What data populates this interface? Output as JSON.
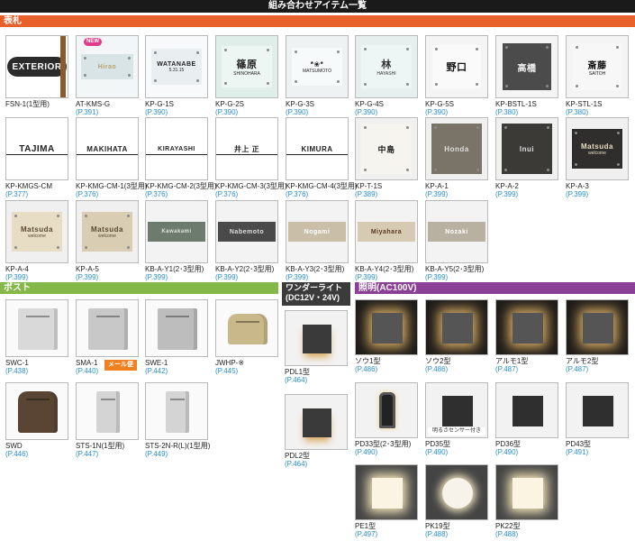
{
  "banner": {
    "title": "組み合わせアイテム一覧"
  },
  "sections": {
    "nameplate": "表札",
    "post": "ポスト",
    "wonder": "ワンダーライト(DC12V・24V)",
    "lighting": "照明(AC100V)"
  },
  "badges": {
    "new": "NEW",
    "mail": "メール便",
    "sensor": "明るさセンサー付き"
  },
  "plates": [
    {
      "code": "FSN-1(1型用)",
      "page": "",
      "text": "EXTERIOR",
      "sub": ""
    },
    {
      "code": "AT-KMS-G",
      "page": "(P.391)",
      "text": "Hirao",
      "sub": ""
    },
    {
      "code": "KP-G-1S",
      "page": "(P.390)",
      "text": "WATANABE",
      "sub": "5.31.15"
    },
    {
      "code": "KP-G-2S",
      "page": "(P.390)",
      "text": "篠原",
      "sub": "SHINOHARA"
    },
    {
      "code": "KP-G-3S",
      "page": "(P.390)",
      "text": "*❀*",
      "sub": "MATSUMOTO"
    },
    {
      "code": "KP-G-4S",
      "page": "(P.390)",
      "text": "林",
      "sub": "HAYASHI"
    },
    {
      "code": "KP-G-5S",
      "page": "(P.390)",
      "text": "野口",
      "sub": ""
    },
    {
      "code": "KP-BSTL-1S",
      "page": "(P.380)",
      "text": "高橋",
      "sub": ""
    },
    {
      "code": "KP-STL-1S",
      "page": "(P.380)",
      "text": "斎藤",
      "sub": "SAITOH"
    },
    {
      "code": "KP-KMGS-CM",
      "page": "(P.377)",
      "text": "TAJIMA",
      "sub": ""
    },
    {
      "code": "KP-KMG-CM-1(3型用)",
      "page": "(P.376)",
      "text": "MAKIHATA",
      "sub": ""
    },
    {
      "code": "KP-KMG-CM-2(3型用)",
      "page": "(P.376)",
      "text": "KIRAYASHI",
      "sub": ""
    },
    {
      "code": "KP-KMG-CM-3(3型用)",
      "page": "(P.376)",
      "text": "井上 正",
      "sub": ""
    },
    {
      "code": "KP-KMG-CM-4(3型用)",
      "page": "(P.376)",
      "text": "KIMURA",
      "sub": ""
    },
    {
      "code": "KP-T-1S",
      "page": "(P.389)",
      "text": "中島",
      "sub": ""
    },
    {
      "code": "KP-A-1",
      "page": "(P.399)",
      "text": "Honda",
      "sub": ""
    },
    {
      "code": "KP-A-2",
      "page": "(P.399)",
      "text": "Inui",
      "sub": ""
    },
    {
      "code": "KP-A-3",
      "page": "(P.399)",
      "text": "Matsuda",
      "sub": "welcome"
    },
    {
      "code": "KP-A-4",
      "page": "(P.399)",
      "text": "Matsuda",
      "sub": "welcome"
    },
    {
      "code": "KP-A-5",
      "page": "(P.399)",
      "text": "Matsuda",
      "sub": "welcome"
    },
    {
      "code": "KB-A-Y1(2･3型用)",
      "page": "(P.399)",
      "text": "Kawakami",
      "sub": ""
    },
    {
      "code": "KB-A-Y2(2･3型用)",
      "page": "(P.399)",
      "text": "Nabemoto",
      "sub": ""
    },
    {
      "code": "KB-A-Y3(2･3型用)",
      "page": "(P.399)",
      "text": "Nogami",
      "sub": ""
    },
    {
      "code": "KB-A-Y4(2･3型用)",
      "page": "(P.399)",
      "text": "Miyahara",
      "sub": ""
    },
    {
      "code": "KB-A-Y5(2･3型用)",
      "page": "(P.399)",
      "text": "Nozaki",
      "sub": ""
    }
  ],
  "posts": [
    {
      "code": "SWC-1",
      "page": "(P.438)"
    },
    {
      "code": "SMA-1",
      "page": "(P.440)"
    },
    {
      "code": "SWE-1",
      "page": "(P.442)"
    },
    {
      "code": "JWHP-※",
      "page": "(P.445)"
    },
    {
      "code": "SWD",
      "page": "(P.446)"
    },
    {
      "code": "STS-1N(1型用)",
      "page": "(P.447)"
    },
    {
      "code": "STS-2N-R(L)(1型用)",
      "page": "(P.449)"
    }
  ],
  "wonder_lights": [
    {
      "code": "PDL1型",
      "page": "(P.464)"
    },
    {
      "code": "PDL2型",
      "page": "(P.464)"
    }
  ],
  "lights": [
    {
      "code": "ソウ1型",
      "page": "(P.486)"
    },
    {
      "code": "ソウ2型",
      "page": "(P.486)"
    },
    {
      "code": "アルモ1型",
      "page": "(P.487)"
    },
    {
      "code": "アルモ2型",
      "page": "(P.487)"
    },
    {
      "code": "PD33型(2･3型用)",
      "page": "(P.490)"
    },
    {
      "code": "PD35型",
      "page": "(P.490)"
    },
    {
      "code": "PD36型",
      "page": "(P.490)"
    },
    {
      "code": "PD43型",
      "page": "(P.491)"
    },
    {
      "code": "PE1型",
      "page": "(P.497)"
    },
    {
      "code": "PK19型",
      "page": "(P.488)"
    },
    {
      "code": "PK22型",
      "page": "(P.488)"
    }
  ],
  "colors": {
    "orange": "#e8612a",
    "green": "#84b94a",
    "purple": "#8b3f96",
    "page_blue": "#2b8fd0"
  }
}
